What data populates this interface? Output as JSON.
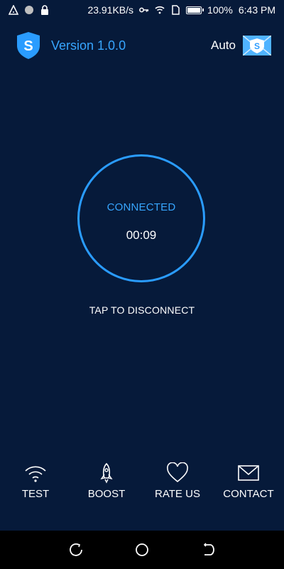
{
  "status_bar": {
    "speed": "23.91KB/s",
    "battery": "100%",
    "battery_level": 1.0,
    "time": "6:43 PM"
  },
  "header": {
    "version": "Version 1.0.0",
    "server_mode": "Auto"
  },
  "connection": {
    "status": "CONNECTED",
    "timer": "00:09",
    "action_hint": "TAP TO DISCONNECT"
  },
  "bottom_nav": [
    {
      "label": "TEST",
      "icon": "wifi-icon"
    },
    {
      "label": "BOOST",
      "icon": "rocket-icon"
    },
    {
      "label": "RATE US",
      "icon": "heart-icon"
    },
    {
      "label": "CONTACT",
      "icon": "envelope-icon"
    }
  ],
  "colors": {
    "background": "#061a3a",
    "accent": "#2a9cff",
    "accent_text": "#37a6ff"
  }
}
